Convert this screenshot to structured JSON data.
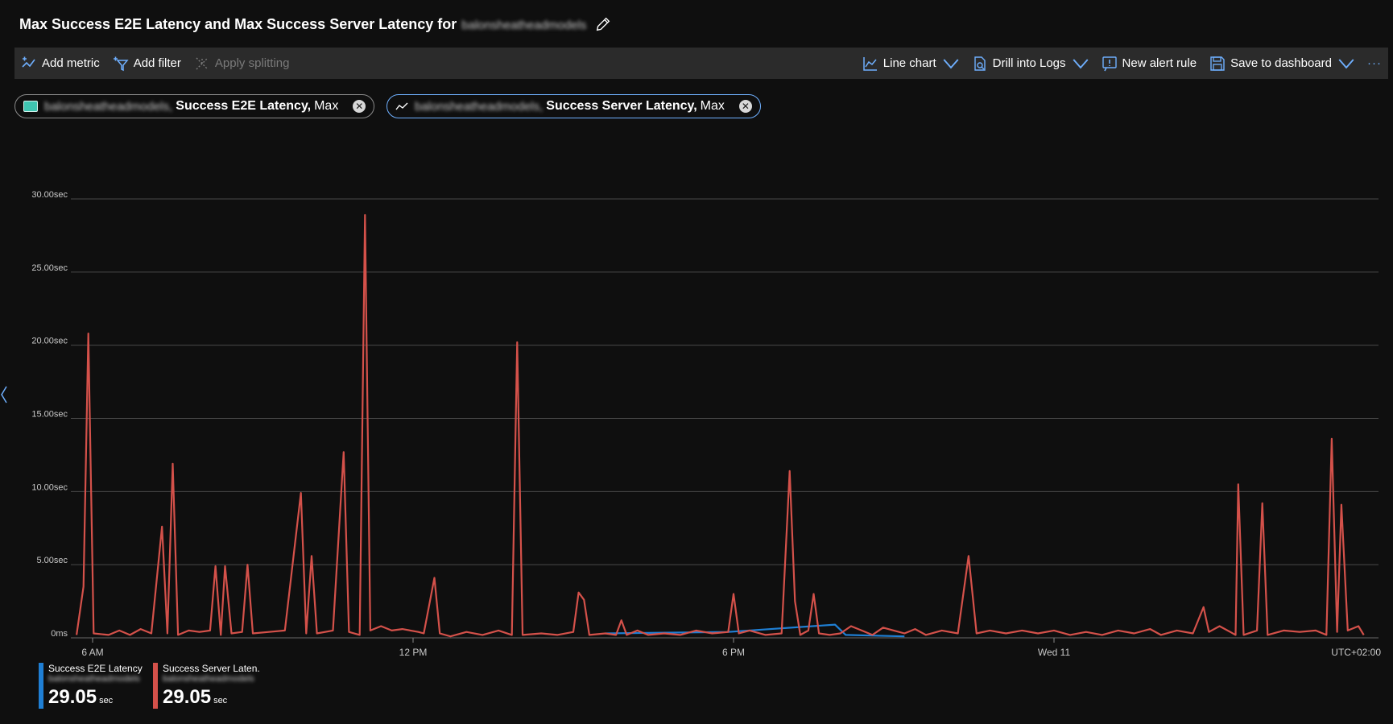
{
  "title": {
    "text": "Max Success E2E Latency and Max Success Server Latency for",
    "resource_redacted": "balonsheatheadmodels"
  },
  "toolbar": {
    "add_metric": "Add metric",
    "add_filter": "Add filter",
    "apply_splitting": "Apply splitting",
    "line_chart": "Line chart",
    "drill_into_logs": "Drill into Logs",
    "new_alert_rule": "New alert rule",
    "save_to_dashboard": "Save to dashboard",
    "more": "···"
  },
  "pills": [
    {
      "resource_redacted": "balonsheatheadmodels,",
      "metric": "Success E2E Latency,",
      "aggregation": "Max",
      "swatch_color": "#3fc4b1"
    },
    {
      "resource_redacted": "balonsheatheadmodels,",
      "metric": "Success Server Latency,",
      "aggregation": "Max"
    }
  ],
  "colors": {
    "e2e": "#1f7fd4",
    "server": "#d4514a",
    "grid": "#4a4a4a",
    "accent": "#6fb0ff"
  },
  "chart_data": {
    "type": "line",
    "y_ticks": [
      "30.00sec",
      "25.00sec",
      "20.00sec",
      "15.00sec",
      "10.00sec",
      "5.00sec",
      "0ms"
    ],
    "x_ticks": [
      "6 AM",
      "12 PM",
      "6 PM",
      "Wed 11"
    ],
    "timezone": "UTC+02:00",
    "ylim": [
      0,
      30
    ],
    "grid": true,
    "x_range_hours": [
      5.7,
      29.8
    ],
    "x_tick_hours": [
      6,
      12,
      18,
      24
    ],
    "series": [
      {
        "name": "Success E2E Latency",
        "color": "#1f7fd4",
        "points": [
          [
            15.6,
            0.3
          ],
          [
            17.9,
            0.4
          ],
          [
            19.9,
            0.9
          ],
          [
            20.1,
            0.2
          ],
          [
            21.2,
            0.1
          ]
        ]
      },
      {
        "name": "Success Server Latency",
        "color": "#d4514a",
        "points": [
          [
            5.7,
            0.2
          ],
          [
            5.83,
            3.5
          ],
          [
            5.92,
            20.8
          ],
          [
            6.02,
            0.3
          ],
          [
            6.3,
            0.2
          ],
          [
            6.5,
            0.5
          ],
          [
            6.7,
            0.2
          ],
          [
            6.9,
            0.6
          ],
          [
            7.1,
            0.3
          ],
          [
            7.3,
            7.6
          ],
          [
            7.4,
            0.3
          ],
          [
            7.5,
            11.9
          ],
          [
            7.6,
            0.2
          ],
          [
            7.8,
            0.5
          ],
          [
            8.0,
            0.4
          ],
          [
            8.2,
            0.5
          ],
          [
            8.3,
            4.9
          ],
          [
            8.4,
            0.2
          ],
          [
            8.48,
            4.9
          ],
          [
            8.6,
            0.3
          ],
          [
            8.8,
            0.4
          ],
          [
            8.9,
            5.0
          ],
          [
            9.0,
            0.3
          ],
          [
            9.3,
            0.4
          ],
          [
            9.6,
            0.5
          ],
          [
            9.9,
            9.9
          ],
          [
            10.0,
            0.3
          ],
          [
            10.1,
            5.6
          ],
          [
            10.2,
            0.3
          ],
          [
            10.5,
            0.5
          ],
          [
            10.7,
            12.7
          ],
          [
            10.8,
            0.4
          ],
          [
            11.0,
            0.2
          ],
          [
            11.1,
            28.9
          ],
          [
            11.2,
            0.5
          ],
          [
            11.4,
            0.8
          ],
          [
            11.6,
            0.5
          ],
          [
            11.8,
            0.6
          ],
          [
            12.1,
            0.4
          ],
          [
            12.2,
            0.3
          ],
          [
            12.4,
            4.1
          ],
          [
            12.5,
            0.3
          ],
          [
            12.7,
            0.1
          ],
          [
            13.0,
            0.4
          ],
          [
            13.3,
            0.2
          ],
          [
            13.6,
            0.5
          ],
          [
            13.85,
            0.2
          ],
          [
            13.95,
            20.2
          ],
          [
            14.05,
            0.2
          ],
          [
            14.4,
            0.3
          ],
          [
            14.7,
            0.2
          ],
          [
            15.0,
            0.4
          ],
          [
            15.1,
            3.1
          ],
          [
            15.2,
            2.6
          ],
          [
            15.3,
            0.2
          ],
          [
            15.6,
            0.3
          ],
          [
            15.8,
            0.2
          ],
          [
            15.9,
            1.2
          ],
          [
            16.0,
            0.2
          ],
          [
            16.2,
            0.5
          ],
          [
            16.4,
            0.2
          ],
          [
            16.7,
            0.3
          ],
          [
            17.0,
            0.2
          ],
          [
            17.3,
            0.5
          ],
          [
            17.6,
            0.3
          ],
          [
            17.9,
            0.4
          ],
          [
            18.0,
            3.0
          ],
          [
            18.1,
            0.3
          ],
          [
            18.3,
            0.5
          ],
          [
            18.6,
            0.2
          ],
          [
            18.9,
            0.3
          ],
          [
            19.05,
            11.4
          ],
          [
            19.15,
            2.5
          ],
          [
            19.25,
            0.2
          ],
          [
            19.4,
            0.5
          ],
          [
            19.5,
            3.0
          ],
          [
            19.6,
            0.3
          ],
          [
            19.8,
            0.2
          ],
          [
            20.0,
            0.3
          ],
          [
            20.2,
            0.8
          ],
          [
            20.4,
            0.5
          ],
          [
            20.6,
            0.2
          ],
          [
            20.8,
            0.7
          ],
          [
            21.0,
            0.5
          ],
          [
            21.2,
            0.3
          ],
          [
            21.4,
            0.6
          ],
          [
            21.6,
            0.2
          ],
          [
            21.9,
            0.5
          ],
          [
            22.2,
            0.3
          ],
          [
            22.4,
            5.6
          ],
          [
            22.55,
            0.3
          ],
          [
            22.8,
            0.5
          ],
          [
            23.1,
            0.3
          ],
          [
            23.4,
            0.5
          ],
          [
            23.7,
            0.3
          ],
          [
            24.0,
            0.5
          ],
          [
            24.3,
            0.2
          ],
          [
            24.6,
            0.4
          ],
          [
            24.9,
            0.2
          ],
          [
            25.2,
            0.5
          ],
          [
            25.5,
            0.3
          ],
          [
            25.8,
            0.6
          ],
          [
            26.0,
            0.2
          ],
          [
            26.3,
            0.5
          ],
          [
            26.6,
            0.3
          ],
          [
            26.8,
            2.1
          ],
          [
            26.9,
            0.4
          ],
          [
            27.1,
            0.8
          ],
          [
            27.3,
            0.4
          ],
          [
            27.4,
            0.2
          ],
          [
            27.45,
            10.5
          ],
          [
            27.55,
            0.2
          ],
          [
            27.8,
            0.5
          ],
          [
            27.9,
            9.2
          ],
          [
            28.0,
            0.2
          ],
          [
            28.3,
            0.5
          ],
          [
            28.6,
            0.4
          ],
          [
            28.9,
            0.5
          ],
          [
            29.1,
            0.2
          ],
          [
            29.2,
            13.6
          ],
          [
            29.3,
            0.4
          ],
          [
            29.38,
            9.1
          ],
          [
            29.5,
            0.5
          ],
          [
            29.7,
            0.8
          ],
          [
            29.8,
            0.2
          ]
        ]
      }
    ]
  },
  "legend": [
    {
      "name": "Success E2E Latency ...",
      "sub_redacted": "balonsheatheadmodels",
      "value": "29.05",
      "unit": "sec",
      "color": "#1f7fd4"
    },
    {
      "name": "Success Server Laten...",
      "sub_redacted": "balonsheatheadmodels",
      "value": "29.05",
      "unit": "sec",
      "color": "#d4514a"
    }
  ]
}
